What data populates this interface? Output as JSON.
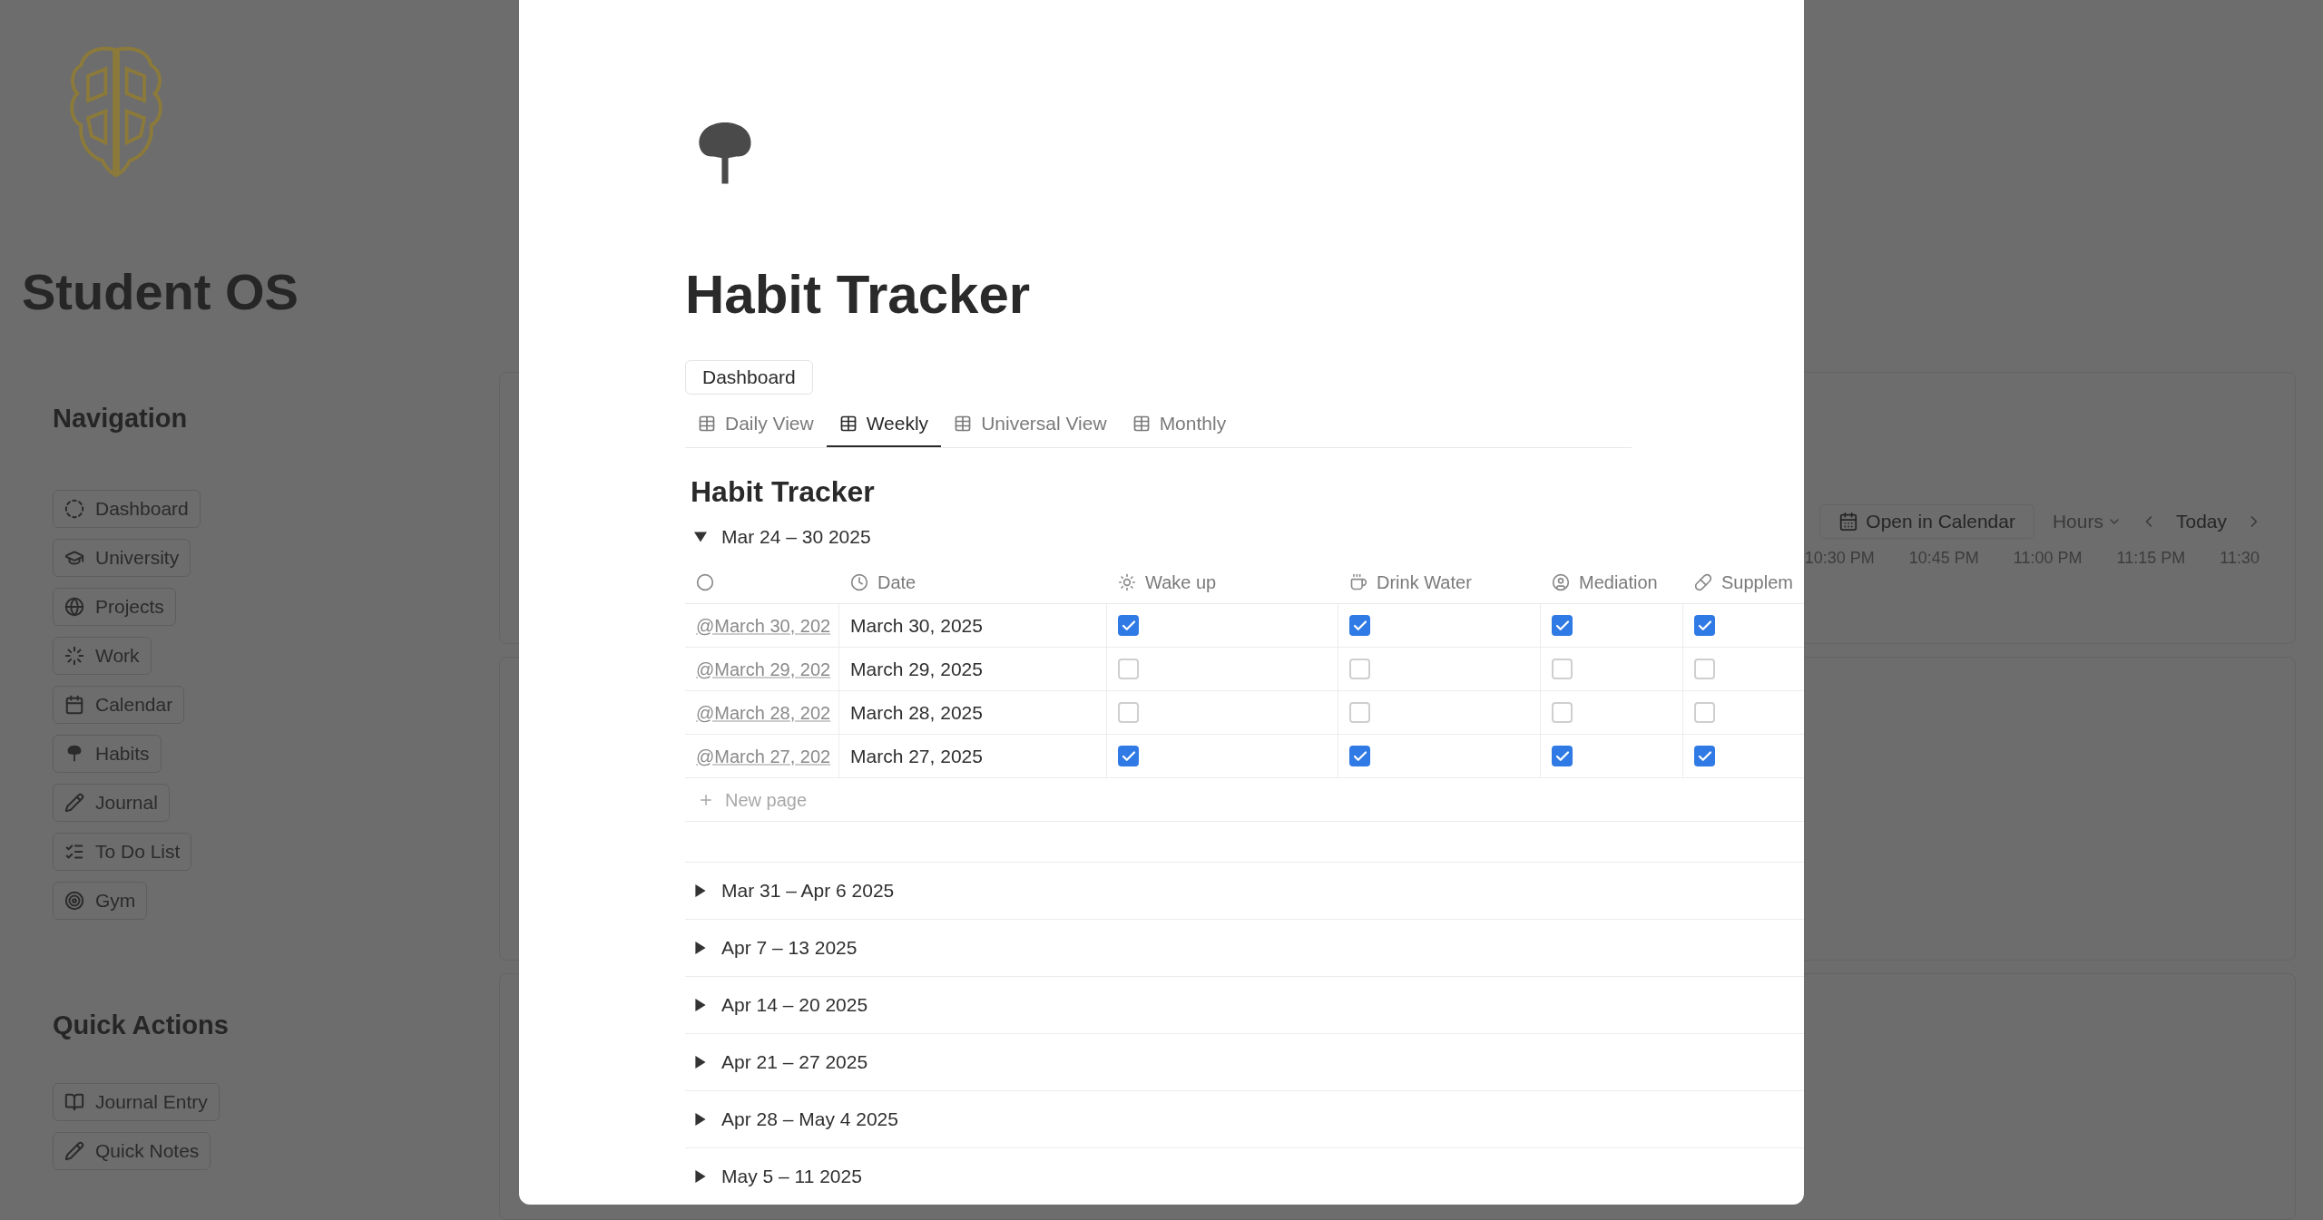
{
  "sidebar": {
    "title": "Student OS",
    "navigation": {
      "heading": "Navigation",
      "items": [
        {
          "label": "Dashboard"
        },
        {
          "label": "University"
        },
        {
          "label": "Projects"
        },
        {
          "label": "Work"
        },
        {
          "label": "Calendar"
        },
        {
          "label": "Habits"
        },
        {
          "label": "Journal"
        },
        {
          "label": "To Do List"
        },
        {
          "label": "Gym"
        }
      ]
    },
    "quick_actions": {
      "heading": "Quick Actions",
      "items": [
        {
          "label": "Journal Entry"
        },
        {
          "label": "Quick Notes"
        }
      ]
    }
  },
  "calendar": {
    "open_button": "Open in Calendar",
    "scale": "Hours",
    "today": "Today",
    "times": [
      "10:30 PM",
      "10:45 PM",
      "11:00 PM",
      "11:15 PM",
      "11:30"
    ]
  },
  "page": {
    "title": "Habit Tracker",
    "breadcrumb": "Dashboard",
    "tabs": [
      {
        "label": "Daily View",
        "selected": false
      },
      {
        "label": "Weekly",
        "selected": true
      },
      {
        "label": "Universal View",
        "selected": false
      },
      {
        "label": "Monthly",
        "selected": false
      }
    ],
    "view_title": "Habit Tracker",
    "columns": [
      {
        "label": "Date"
      },
      {
        "label": "Wake up"
      },
      {
        "label": "Drink Water"
      },
      {
        "label": "Mediation"
      },
      {
        "label": "Supplem"
      }
    ],
    "groups": [
      {
        "label": "Mar 24 – 30 2025",
        "expanded": true,
        "rows": [
          {
            "title": "@March 30, 202",
            "date": "March 30, 2025",
            "checks": [
              true,
              true,
              true,
              true
            ]
          },
          {
            "title": "@March 29, 202",
            "date": "March 29, 2025",
            "checks": [
              false,
              false,
              false,
              false
            ]
          },
          {
            "title": "@March 28, 202",
            "date": "March 28, 2025",
            "checks": [
              false,
              false,
              false,
              false
            ]
          },
          {
            "title": "@March 27, 202",
            "date": "March 27, 2025",
            "checks": [
              true,
              true,
              true,
              true
            ]
          }
        ],
        "new_page": "New page"
      },
      {
        "label": "Mar 31 – Apr 6 2025",
        "expanded": false
      },
      {
        "label": "Apr 7 – 13 2025",
        "expanded": false
      },
      {
        "label": "Apr 14 – 20 2025",
        "expanded": false
      },
      {
        "label": "Apr 21 – 27 2025",
        "expanded": false
      },
      {
        "label": "Apr 28 – May 4 2025",
        "expanded": false
      },
      {
        "label": "May 5 – 11 2025",
        "expanded": false
      }
    ]
  }
}
